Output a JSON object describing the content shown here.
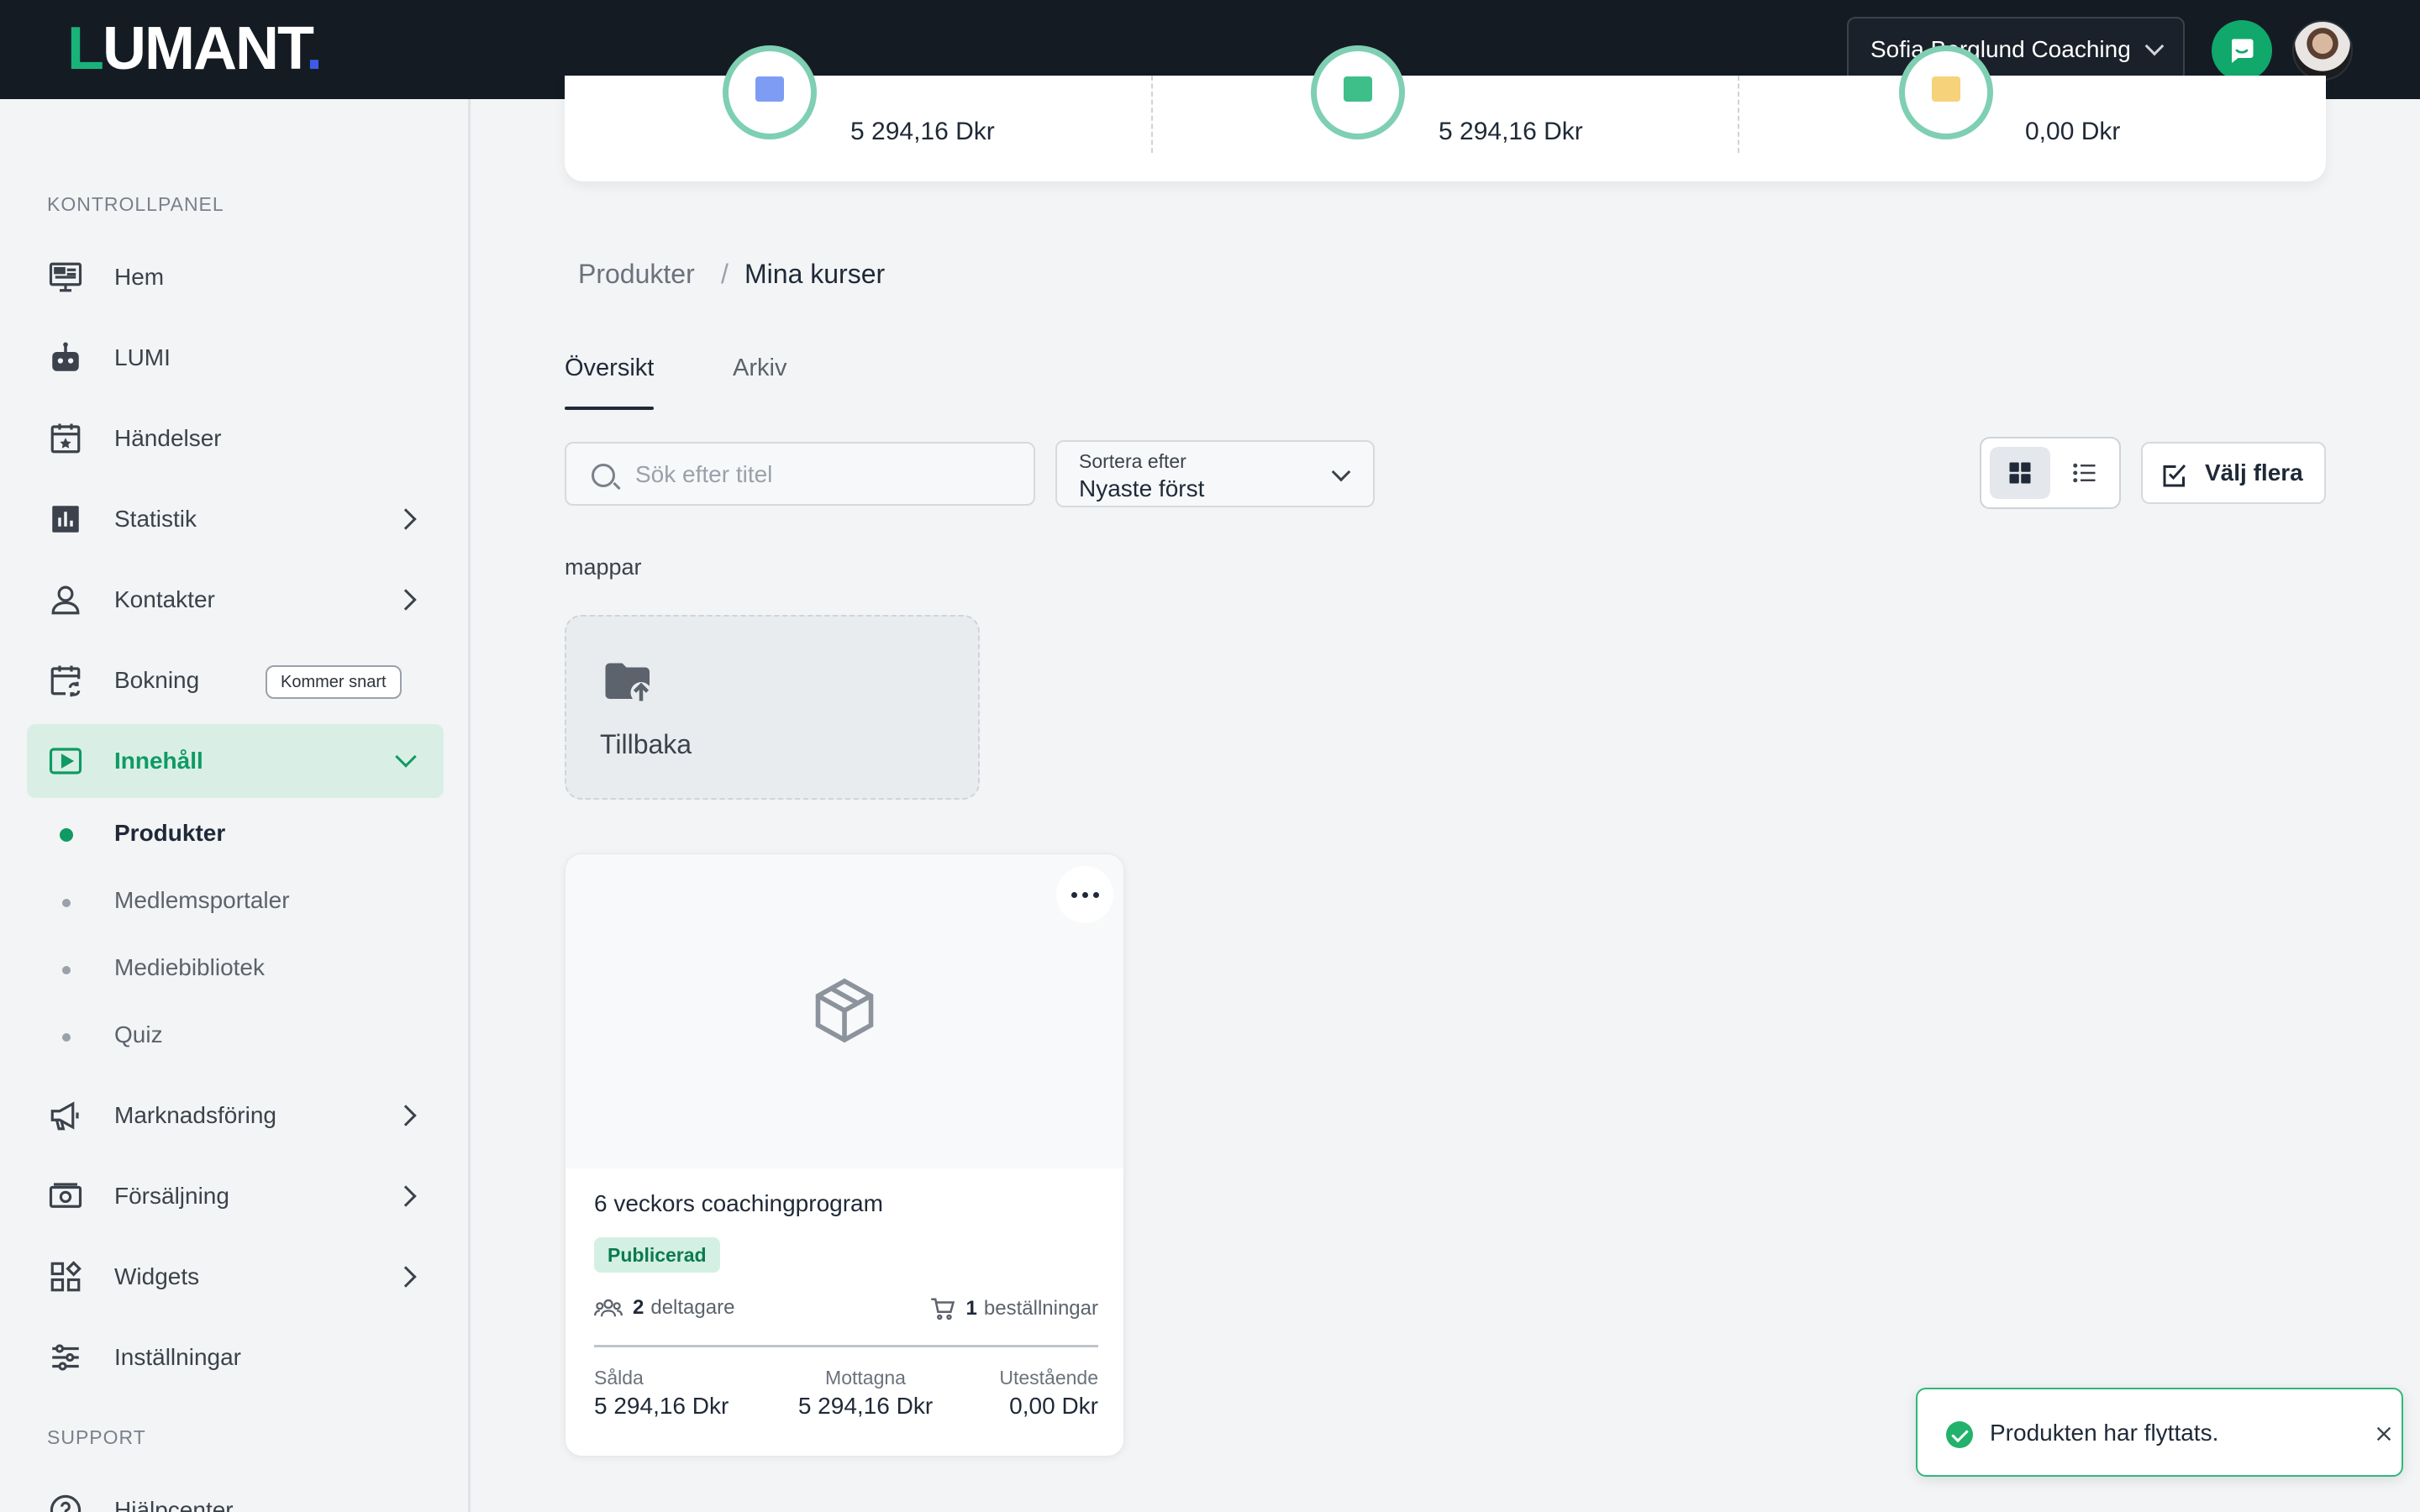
{
  "header": {
    "logo": {
      "first": "L",
      "rest": "UMANT",
      "dot": "."
    },
    "account": "Sofia Berglund Coaching",
    "chat_icon": "chat-icon",
    "avatar_icon": "user-avatar"
  },
  "sidebar": {
    "section_main": "KONTROLLPANEL",
    "items": [
      {
        "label": "Hem",
        "icon": "monitor-icon"
      },
      {
        "label": "LUMI",
        "icon": "robot-icon"
      },
      {
        "label": "Händelser",
        "icon": "calendar-star-icon"
      },
      {
        "label": "Statistik",
        "icon": "bar-chart-icon"
      },
      {
        "label": "Kontakter",
        "icon": "user-icon"
      },
      {
        "label": "Bokning",
        "icon": "calendar-sync-icon",
        "badge": "Kommer snart"
      },
      {
        "label": "Innehåll",
        "icon": "play-icon"
      },
      {
        "label": "Marknadsföring",
        "icon": "megaphone-icon"
      },
      {
        "label": "Försäljning",
        "icon": "money-icon"
      },
      {
        "label": "Widgets",
        "icon": "widgets-icon"
      },
      {
        "label": "Inställningar",
        "icon": "sliders-icon"
      }
    ],
    "sub_items": [
      "Produkter",
      "Medlemsportaler",
      "Mediebibliotek",
      "Quiz"
    ],
    "section_support": "SUPPORT",
    "support_items": [
      {
        "label": "Hjälpcenter",
        "icon": "help-icon"
      }
    ]
  },
  "stats": [
    {
      "value": "5 294,16 Dkr",
      "color": "#5b7cf0"
    },
    {
      "value": "5 294,16 Dkr",
      "color": "#19b37a"
    },
    {
      "value": "0,00 Dkr",
      "color": "#f2b52c"
    }
  ],
  "breadcrumb": {
    "parent": "Produkter",
    "separator": "/",
    "current": "Mina kurser"
  },
  "tabs": [
    {
      "label": "Översikt",
      "active": true
    },
    {
      "label": "Arkiv",
      "active": false
    }
  ],
  "search": {
    "placeholder": "Sök efter titel",
    "value": ""
  },
  "sort": {
    "label": "Sortera efter",
    "value": "Nyaste först"
  },
  "select_multiple": "Välj flera",
  "folders": {
    "label": "mappar",
    "back": "Tillbaka"
  },
  "product": {
    "title": "6 veckors coachingprogram",
    "status": "Publicerad",
    "participants_count": "2",
    "participants_label": "deltagare",
    "orders_count": "1",
    "orders_label": "beställningar",
    "sold_label": "Sålda",
    "sold_value": "5 294,16 Dkr",
    "received_label": "Mottagna",
    "received_value": "5 294,16 Dkr",
    "outstanding_label": "Utestående",
    "outstanding_value": "0,00 Dkr"
  },
  "toast": {
    "message": "Produkten har flyttats."
  }
}
